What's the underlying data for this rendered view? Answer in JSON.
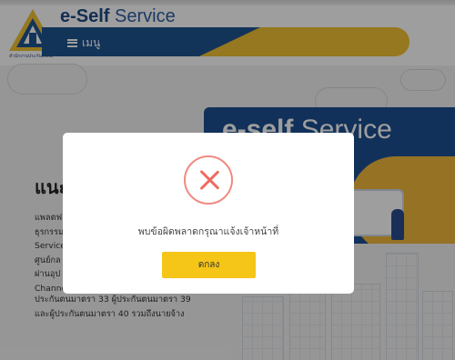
{
  "header": {
    "app_title_bold": "e-Self",
    "app_title_light": "Service",
    "logo_caption": "สำนักงานประกันสังคม",
    "menu_label": "เมนู"
  },
  "banner": {
    "title_bold": "e-self",
    "title_light": "Service"
  },
  "intro": {
    "heading": "แนะ",
    "lines": [
      "แพลตฟ",
      "ธุรกรรม",
      "Service",
      "ศูนย์กล",
      "ผ่านอุป",
      "Channe"
    ],
    "tail_lines": [
      "ประกันตนมาตรา 33 ผู้ประกันตนมาตรา 39",
      "และผู้ประกันตนมาตรา 40 รวมถึงนายจ้าง"
    ]
  },
  "dialog": {
    "icon": "error-x-icon",
    "message": "พบข้อผิดพลาดกรุณาแจ้งเจ้าหน้าที่",
    "ok_label": "ตกลง"
  },
  "colors": {
    "brand_blue": "#1f5490",
    "brand_yellow": "#f0c232",
    "error_red": "#f06a5e",
    "button_yellow": "#f5c518"
  }
}
